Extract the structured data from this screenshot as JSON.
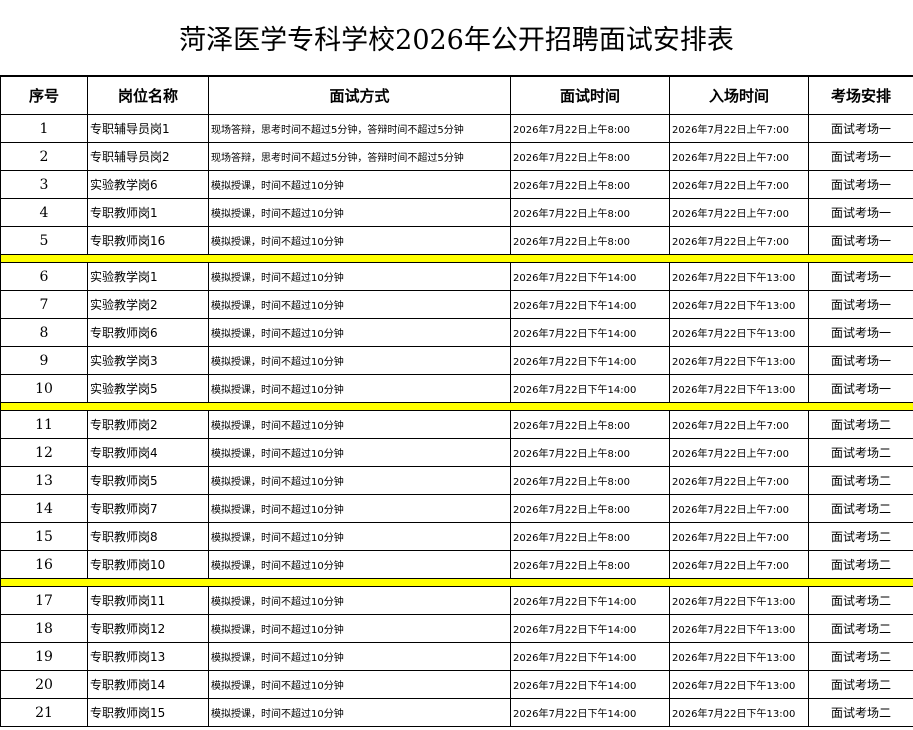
{
  "title": "菏泽医学专科学校2026年公开招聘面试安排表",
  "headers": [
    "序号",
    "岗位名称",
    "面试方式",
    "面试时间",
    "入场时间",
    "考场安排"
  ],
  "groups": [
    [
      [
        "1",
        "专职辅导员岗1",
        "现场答辩，思考时间不超过5分钟，答辩时间不超过5分钟",
        "2026年7月22日上午8:00",
        "2026年7月22日上午7:00",
        "面试考场一"
      ],
      [
        "2",
        "专职辅导员岗2",
        "现场答辩，思考时间不超过5分钟，答辩时间不超过5分钟",
        "2026年7月22日上午8:00",
        "2026年7月22日上午7:00",
        "面试考场一"
      ],
      [
        "3",
        "实验教学岗6",
        "模拟授课，时间不超过10分钟",
        "2026年7月22日上午8:00",
        "2026年7月22日上午7:00",
        "面试考场一"
      ],
      [
        "4",
        "专职教师岗1",
        "模拟授课，时间不超过10分钟",
        "2026年7月22日上午8:00",
        "2026年7月22日上午7:00",
        "面试考场一"
      ],
      [
        "5",
        "专职教师岗16",
        "模拟授课，时间不超过10分钟",
        "2026年7月22日上午8:00",
        "2026年7月22日上午7:00",
        "面试考场一"
      ]
    ],
    [
      [
        "6",
        "实验教学岗1",
        "模拟授课，时间不超过10分钟",
        "2026年7月22日下午14:00",
        "2026年7月22日下午13:00",
        "面试考场一"
      ],
      [
        "7",
        "实验教学岗2",
        "模拟授课，时间不超过10分钟",
        "2026年7月22日下午14:00",
        "2026年7月22日下午13:00",
        "面试考场一"
      ],
      [
        "8",
        "专职教师岗6",
        "模拟授课，时间不超过10分钟",
        "2026年7月22日下午14:00",
        "2026年7月22日下午13:00",
        "面试考场一"
      ],
      [
        "9",
        "实验教学岗3",
        "模拟授课，时间不超过10分钟",
        "2026年7月22日下午14:00",
        "2026年7月22日下午13:00",
        "面试考场一"
      ],
      [
        "10",
        "实验教学岗5",
        "模拟授课，时间不超过10分钟",
        "2026年7月22日下午14:00",
        "2026年7月22日下午13:00",
        "面试考场一"
      ]
    ],
    [
      [
        "11",
        "专职教师岗2",
        "模拟授课，时间不超过10分钟",
        "2026年7月22日上午8:00",
        "2026年7月22日上午7:00",
        "面试考场二"
      ],
      [
        "12",
        "专职教师岗4",
        "模拟授课，时间不超过10分钟",
        "2026年7月22日上午8:00",
        "2026年7月22日上午7:00",
        "面试考场二"
      ],
      [
        "13",
        "专职教师岗5",
        "模拟授课，时间不超过10分钟",
        "2026年7月22日上午8:00",
        "2026年7月22日上午7:00",
        "面试考场二"
      ],
      [
        "14",
        "专职教师岗7",
        "模拟授课，时间不超过10分钟",
        "2026年7月22日上午8:00",
        "2026年7月22日上午7:00",
        "面试考场二"
      ],
      [
        "15",
        "专职教师岗8",
        "模拟授课，时间不超过10分钟",
        "2026年7月22日上午8:00",
        "2026年7月22日上午7:00",
        "面试考场二"
      ],
      [
        "16",
        "专职教师岗10",
        "模拟授课，时间不超过10分钟",
        "2026年7月22日上午8:00",
        "2026年7月22日上午7:00",
        "面试考场二"
      ]
    ],
    [
      [
        "17",
        "专职教师岗11",
        "模拟授课，时间不超过10分钟",
        "2026年7月22日下午14:00",
        "2026年7月22日下午13:00",
        "面试考场二"
      ],
      [
        "18",
        "专职教师岗12",
        "模拟授课，时间不超过10分钟",
        "2026年7月22日下午14:00",
        "2026年7月22日下午13:00",
        "面试考场二"
      ],
      [
        "19",
        "专职教师岗13",
        "模拟授课，时间不超过10分钟",
        "2026年7月22日下午14:00",
        "2026年7月22日下午13:00",
        "面试考场二"
      ],
      [
        "20",
        "专职教师岗14",
        "模拟授课，时间不超过10分钟",
        "2026年7月22日下午14:00",
        "2026年7月22日下午13:00",
        "面试考场二"
      ],
      [
        "21",
        "专职教师岗15",
        "模拟授课，时间不超过10分钟",
        "2026年7月22日下午14:00",
        "2026年7月22日下午13:00",
        "面试考场二"
      ]
    ]
  ],
  "colors": {
    "separator": "#ffff00",
    "grid": "#000000"
  }
}
